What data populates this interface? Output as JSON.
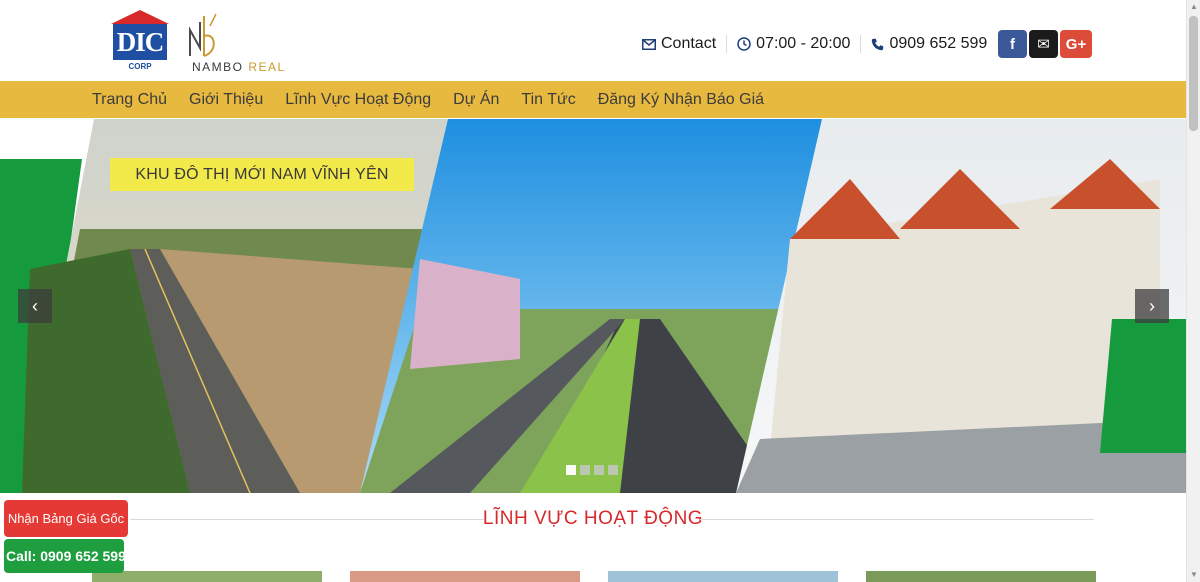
{
  "header": {
    "logo_dic": {
      "text": "DIC",
      "sub": "CORP"
    },
    "logo_nambo": {
      "text_a": "NAMBO",
      "text_b": "REAL"
    },
    "contact_label": "Contact",
    "hours": "07:00 - 20:00",
    "phone": "0909 652 599",
    "social": {
      "facebook": "f",
      "email": "✉",
      "gplus": "G+"
    }
  },
  "nav": {
    "items": [
      "Trang Chủ",
      "Giới Thiệu",
      "Lĩnh Vực Hoạt Động",
      "Dự Án",
      "Tin Tức",
      "Đăng Ký Nhận Báo Giá"
    ]
  },
  "slider": {
    "caption": "KHU ĐÔ THỊ MỚI NAM VĨNH YÊN",
    "prev_icon": "‹",
    "next_icon": "›",
    "slide_count": 4,
    "active_slide": 1
  },
  "section": {
    "title": "LĨNH VỰC HOẠT ĐỘNG"
  },
  "floating": {
    "price_button": "Nhận Bảng Giá Gốc",
    "call_button": "Call: 0909 652 599"
  },
  "colors": {
    "nav_bg": "#e7b93f",
    "accent_red": "#d7282a",
    "caption_bg": "#f2ea4a",
    "call_green": "#1e9e3e"
  }
}
